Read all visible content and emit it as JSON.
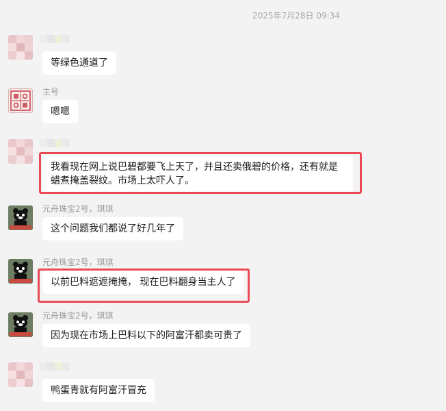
{
  "chat": {
    "timestamp": "2025年7月28日 09:34",
    "messages": [
      {
        "sender": "",
        "avatar": "blurred-avatar",
        "text": "等绿色通道了",
        "highlighted": false
      },
      {
        "sender": "主号",
        "avatar": "seal-logo-avatar",
        "text": "嗯嗯",
        "highlighted": false
      },
      {
        "sender": "",
        "avatar": "blurred-avatar",
        "text": "我看现在网上说巴碧都要飞上天了，并且还卖俄碧的价格，还有就是蜡煮掩盖裂纹。市场上太吓人了。",
        "highlighted": true
      },
      {
        "sender": "元舟珠宝2号，琪琪",
        "avatar": "mascot-avatar",
        "text": "这个问题我们都说了好几年了",
        "highlighted": false
      },
      {
        "sender": "元舟珠宝2号，琪琪",
        "avatar": "mascot-avatar",
        "text": "以前巴料遮遮掩掩， 现在巴料翻身当主人了",
        "highlighted": true
      },
      {
        "sender": "元舟珠宝2号，琪琪",
        "avatar": "mascot-avatar",
        "text": "因为现在市场上巴料以下的阿富汗都卖可贵了",
        "highlighted": false
      },
      {
        "sender": "",
        "avatar": "blurred-avatar",
        "text": "鸭蛋青就有阿富汗冒充",
        "highlighted": false
      }
    ]
  },
  "colors": {
    "background": "#f3f3f3",
    "bubble": "#ffffff",
    "highlight": "#e94a55",
    "meta_text": "#9a9a9a"
  }
}
